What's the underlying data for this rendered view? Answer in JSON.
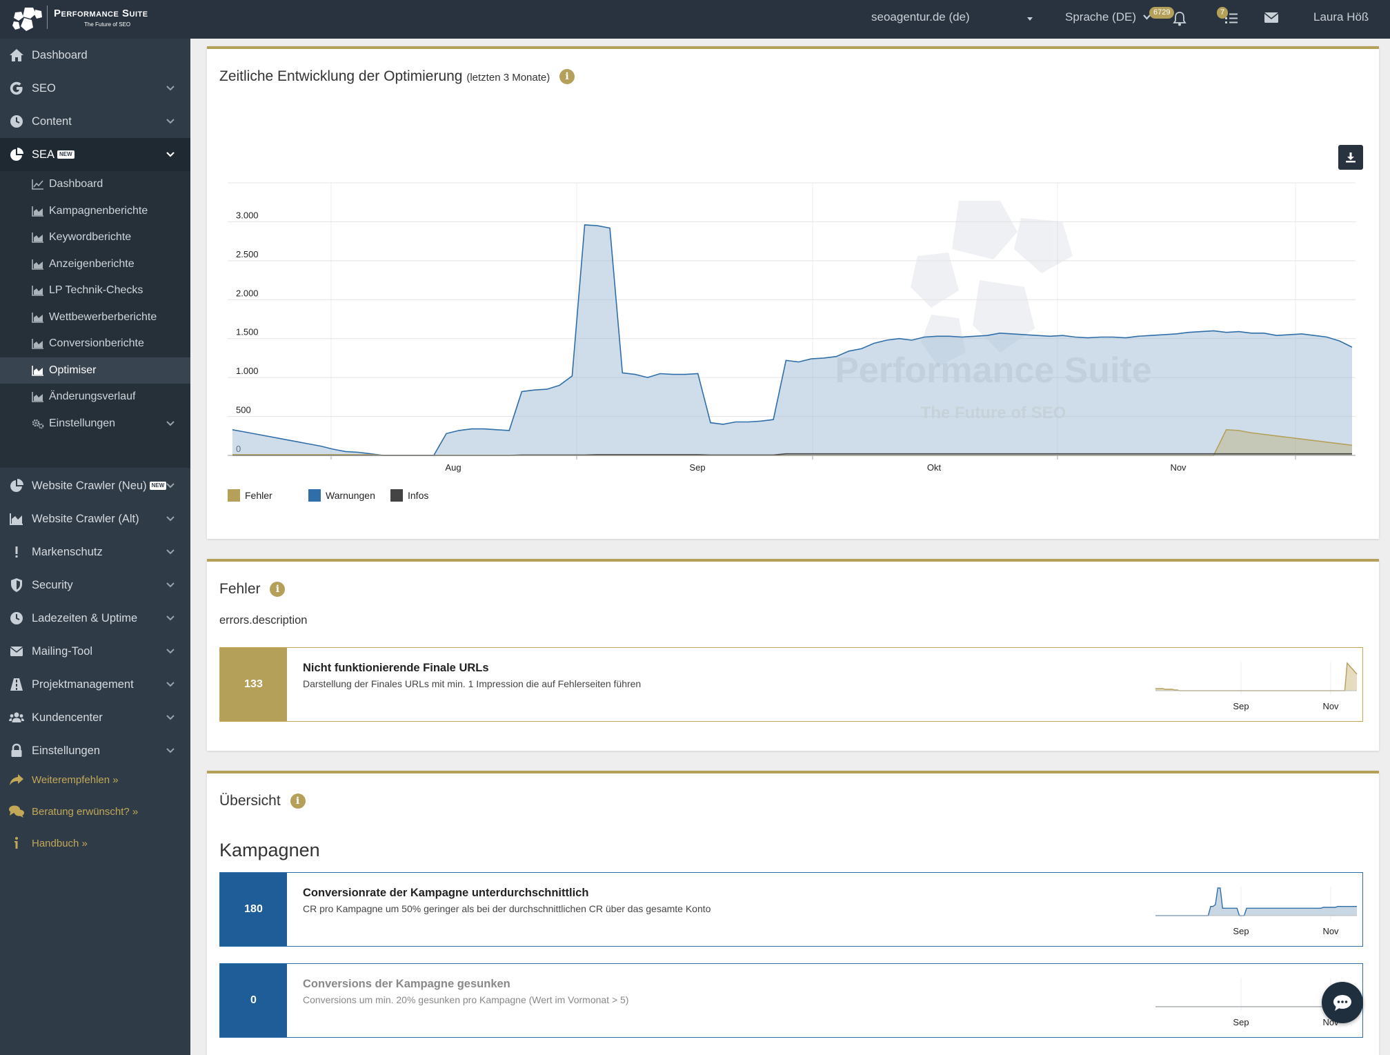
{
  "brand": {
    "title": "Performance Suite",
    "subtitle": "The Future of SEO"
  },
  "topbar": {
    "project": "seoagentur.de (de)",
    "language": "Sprache (DE)",
    "notifications_count": "6729",
    "tasks_count": "7",
    "user": "Laura Höß"
  },
  "sidebar": {
    "items": [
      {
        "label": "Dashboard",
        "icon": "home-icon"
      },
      {
        "label": "SEO",
        "icon": "google-icon"
      },
      {
        "label": "Content",
        "icon": "clock-icon"
      },
      {
        "label": "SEA",
        "icon": "pie-icon",
        "badge": "NEW"
      },
      {
        "label": "Website Crawler (Neu)",
        "icon": "pie-icon",
        "badge": "NEW"
      },
      {
        "label": "Website Crawler (Alt)",
        "icon": "area-chart-icon"
      },
      {
        "label": "Markenschutz",
        "icon": "exclamation-icon"
      },
      {
        "label": "Security",
        "icon": "shield-icon"
      },
      {
        "label": "Ladezeiten & Uptime",
        "icon": "clock-icon"
      },
      {
        "label": "Mailing-Tool",
        "icon": "envelope-icon"
      },
      {
        "label": "Projektmanagement",
        "icon": "road-icon"
      },
      {
        "label": "Kundencenter",
        "icon": "users-icon"
      },
      {
        "label": "Einstellungen",
        "icon": "lock-icon"
      }
    ],
    "sea_sub": [
      {
        "label": "Dashboard",
        "icon": "line-chart-icon"
      },
      {
        "label": "Kampagnenberichte",
        "icon": "area-chart-icon"
      },
      {
        "label": "Keywordberichte",
        "icon": "area-chart-icon"
      },
      {
        "label": "Anzeigenberichte",
        "icon": "area-chart-icon"
      },
      {
        "label": "LP Technik-Checks",
        "icon": "area-chart-icon"
      },
      {
        "label": "Wettbewerberberichte",
        "icon": "area-chart-icon"
      },
      {
        "label": "Conversionberichte",
        "icon": "area-chart-icon"
      },
      {
        "label": "Optimiser",
        "icon": "area-chart-icon"
      },
      {
        "label": "Änderungsverlauf",
        "icon": "area-chart-icon"
      },
      {
        "label": "Einstellungen",
        "icon": "gears-icon"
      }
    ],
    "links": [
      {
        "label": "Weiterempfehlen »",
        "icon": "share-icon"
      },
      {
        "label": "Beratung erwünscht? »",
        "icon": "comments-icon"
      },
      {
        "label": "Handbuch »",
        "icon": "info-icon"
      }
    ]
  },
  "main_chart": {
    "title": "Zeitliche Entwicklung der Optimierung",
    "title_suffix": "(letzten 3 Monate)",
    "watermark_title": "Performance Suite",
    "watermark_sub": "The Future of SEO"
  },
  "chart_data": {
    "type": "area",
    "x_ticks": [
      "Aug",
      "Sep",
      "Okt",
      "Nov"
    ],
    "y_ticks": [
      "0",
      "500",
      "1.000",
      "1.500",
      "2.000",
      "2.500",
      "3.000"
    ],
    "ylim": [
      0,
      3500
    ],
    "legend": [
      "Fehler",
      "Warnungen",
      "Infos"
    ],
    "colors": {
      "Fehler": "#b5a05a",
      "Warnungen": "#2f6ea8",
      "Infos": "#444444"
    },
    "grid": true,
    "series": [
      {
        "name": "Warnungen",
        "values": [
          330,
          300,
          270,
          240,
          210,
          180,
          150,
          120,
          80,
          50,
          40,
          20,
          0,
          0,
          0,
          0,
          0,
          280,
          320,
          340,
          340,
          330,
          320,
          820,
          840,
          850,
          900,
          1020,
          2960,
          2950,
          2920,
          1060,
          1040,
          1000,
          1050,
          1040,
          1040,
          1050,
          420,
          400,
          430,
          430,
          440,
          460,
          1220,
          1200,
          1240,
          1250,
          1270,
          1340,
          1370,
          1440,
          1480,
          1500,
          1480,
          1520,
          1530,
          1530,
          1520,
          1530,
          1540,
          1570,
          1560,
          1550,
          1540,
          1530,
          1540,
          1520,
          1510,
          1520,
          1520,
          1510,
          1530,
          1540,
          1550,
          1560,
          1580,
          1590,
          1600,
          1580,
          1590,
          1570,
          1570,
          1540,
          1550,
          1560,
          1540,
          1520,
          1470,
          1390
        ]
      },
      {
        "name": "Fehler",
        "values": [
          10,
          10,
          10,
          10,
          10,
          10,
          10,
          10,
          10,
          10,
          10,
          10,
          0,
          0,
          0,
          0,
          0,
          0,
          0,
          0,
          0,
          0,
          0,
          0,
          0,
          0,
          0,
          0,
          0,
          0,
          0,
          0,
          0,
          0,
          0,
          0,
          0,
          0,
          0,
          0,
          0,
          0,
          0,
          0,
          0,
          0,
          0,
          0,
          0,
          0,
          0,
          0,
          0,
          0,
          0,
          0,
          0,
          0,
          0,
          0,
          0,
          0,
          0,
          0,
          0,
          0,
          0,
          0,
          0,
          0,
          0,
          0,
          0,
          0,
          0,
          0,
          0,
          0,
          0,
          330,
          320,
          290,
          270,
          250,
          230,
          210,
          190,
          170,
          150,
          130
        ]
      },
      {
        "name": "Infos",
        "values": [
          0,
          0,
          0,
          0,
          0,
          0,
          0,
          0,
          0,
          0,
          0,
          0,
          0,
          0,
          0,
          0,
          0,
          0,
          0,
          0,
          0,
          0,
          0,
          5,
          5,
          5,
          5,
          5,
          5,
          10,
          10,
          10,
          10,
          10,
          10,
          10,
          10,
          10,
          5,
          5,
          5,
          5,
          5,
          5,
          20,
          20,
          20,
          20,
          20,
          20,
          20,
          20,
          20,
          20,
          20,
          20,
          20,
          20,
          20,
          20,
          20,
          20,
          20,
          20,
          20,
          20,
          20,
          20,
          20,
          20,
          20,
          20,
          20,
          20,
          20,
          20,
          20,
          20,
          20,
          20,
          20,
          20,
          20,
          20,
          20,
          20,
          20,
          20,
          20,
          20
        ]
      }
    ]
  },
  "fehler_section": {
    "title": "Fehler",
    "description": "errors.description",
    "issues": [
      {
        "count": "133",
        "title": "Nicht funktionierende Finale URLs",
        "desc": "Darstellung der Finales URLs mit min. 1 Impression die auf Fehlerseiten führen",
        "spark_ticks": [
          "Sep",
          "Nov"
        ],
        "spark_values": [
          3,
          3,
          3,
          3,
          2,
          2,
          2,
          2,
          1,
          1,
          0,
          0,
          0,
          0,
          0,
          0,
          0,
          0,
          0,
          0,
          0,
          0,
          0,
          0,
          0,
          0,
          0,
          0,
          0,
          0,
          0,
          0,
          0,
          0,
          0,
          0,
          0,
          0,
          0,
          0,
          0,
          0,
          0,
          0,
          0,
          0,
          0,
          0,
          0,
          0,
          0,
          0,
          0,
          0,
          0,
          0,
          0,
          0,
          0,
          0,
          0,
          0,
          0,
          0,
          0,
          0,
          0,
          0,
          0,
          0,
          0,
          0,
          0,
          0,
          0,
          0,
          0,
          0,
          0,
          40,
          36,
          32,
          28,
          24
        ]
      }
    ]
  },
  "overview_section": {
    "title": "Übersicht",
    "subtitle": "Kampagnen",
    "issues": [
      {
        "count": "180",
        "title": "Conversionrate der Kampagne unterdurchschnittlich",
        "desc": "CR pro Kampagne um 50% geringer als bei der durchschnittlichen CR über das gesamte Konto",
        "spark_ticks": [
          "Sep",
          "Nov"
        ],
        "spark_values": [
          0,
          0,
          0,
          0,
          0,
          0,
          0,
          0,
          0,
          0,
          0,
          0,
          0,
          0,
          0,
          0,
          0,
          0,
          0,
          0,
          0,
          0,
          0,
          10,
          10,
          12,
          30,
          30,
          8,
          8,
          8,
          8,
          8,
          8,
          8,
          0,
          0,
          0,
          8,
          8,
          8,
          8,
          8,
          8,
          8,
          8,
          8,
          8,
          8,
          8,
          8,
          8,
          8,
          8,
          8,
          8,
          8,
          8,
          8,
          8,
          8,
          8,
          8,
          8,
          8,
          8,
          8,
          8,
          8,
          8,
          9,
          9,
          9,
          9,
          9,
          9,
          10,
          10,
          10,
          10,
          10,
          10,
          10,
          10,
          10
        ]
      },
      {
        "count": "0",
        "title": "Conversions der Kampagne gesunken",
        "desc": "Conversions um min. 20% gesunken pro Kampagne (Wert im Vormonat > 5)",
        "spark_ticks": [
          "Sep",
          "Nov"
        ],
        "spark_values": [
          0,
          0,
          0,
          0,
          0,
          0,
          0,
          0,
          0,
          0,
          0,
          0,
          0,
          0,
          0,
          0,
          0,
          0,
          0,
          0,
          0,
          0,
          0,
          0,
          0,
          0,
          0,
          0,
          0,
          0,
          0,
          0,
          0,
          0,
          0,
          0,
          0,
          0,
          0,
          0,
          0,
          0,
          0,
          0,
          0,
          0,
          0,
          0,
          0,
          0,
          0,
          0,
          0,
          0,
          0,
          0,
          0,
          0,
          0,
          0,
          0,
          0,
          0,
          0,
          0,
          0,
          0,
          0,
          0,
          0,
          0,
          0,
          0,
          0,
          0,
          0,
          0,
          0,
          0,
          0,
          0,
          0,
          0,
          0
        ]
      }
    ]
  }
}
